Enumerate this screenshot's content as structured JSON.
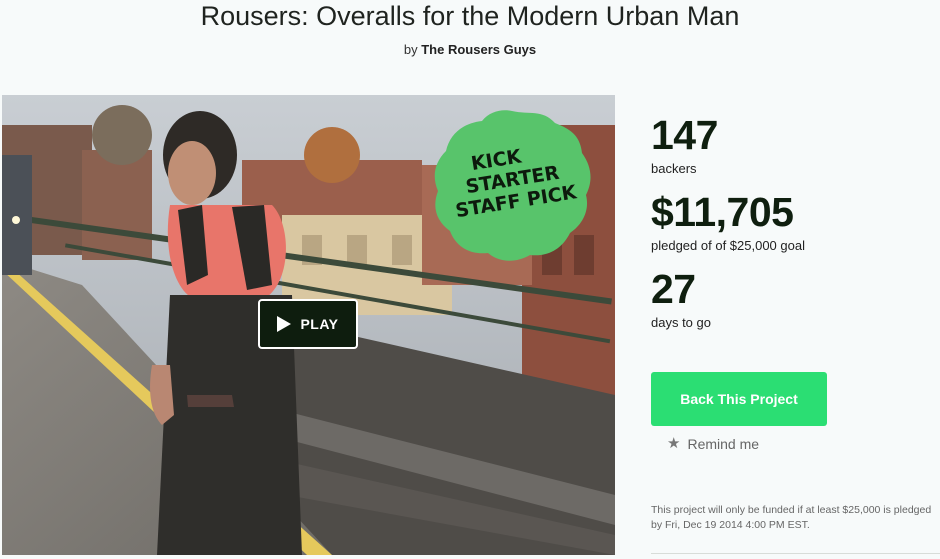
{
  "project": {
    "title": "Rousers: Overalls for the Modern Urban Man",
    "by_prefix": "by",
    "creator": "The Rousers Guys"
  },
  "video": {
    "play_label": "PLAY",
    "badge_lines": [
      "KICK",
      "STARTER",
      "STAFF PICK"
    ],
    "badge_color": "#58c46b"
  },
  "stats": {
    "backers_count": "147",
    "backers_label": "backers",
    "pledged_amount": "$11,705",
    "pledged_label": "pledged of of $25,000 goal",
    "days_count": "27",
    "days_label": "days to go"
  },
  "actions": {
    "back_label": "Back This Project",
    "back_color": "#2bde73",
    "remind_label": "Remind me",
    "remind_icon": "star-icon"
  },
  "fine_print": "This project will only be funded if at least $25,000 is pledged by Fri, Dec 19 2014 4:00 PM EST."
}
